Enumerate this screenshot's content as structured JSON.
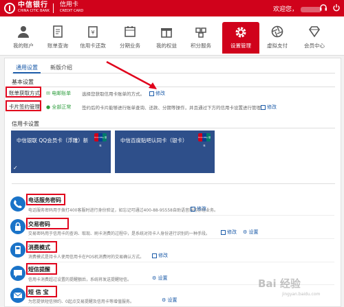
{
  "header": {
    "logo_cn": "中信银行",
    "logo_en": "CHINA CITIC BANK",
    "product": "信用卡",
    "product_en": "CREDIT CARD",
    "welcome": "欢迎您，"
  },
  "nav": {
    "items": [
      {
        "label": "我的账户",
        "icon": "person-icon"
      },
      {
        "label": "账单查询",
        "icon": "bill-icon"
      },
      {
        "label": "信用卡还款",
        "icon": "card-icon"
      },
      {
        "label": "分期业务",
        "icon": "calendar-icon"
      },
      {
        "label": "我的权益",
        "icon": "gift-icon"
      },
      {
        "label": "积分服务",
        "icon": "points-icon"
      },
      {
        "label": "设置管理",
        "icon": "gear-icon"
      },
      {
        "label": "虚拟支付",
        "icon": "aperture-icon"
      },
      {
        "label": "会员中心",
        "icon": "diamond-icon"
      }
    ]
  },
  "tabs": {
    "general": "通用设置",
    "new_version": "新版介绍"
  },
  "basic": {
    "title": "基本设置",
    "rows": [
      {
        "label": "账单获取方式",
        "status": "电邮账单",
        "desc": "选择您获取信用卡账单的方式。",
        "action": "修改"
      },
      {
        "label": "卡片签约管理",
        "status": "全部正常",
        "desc": "签约后的卡片能够进行账单查询、还款、分期等操作，并且通过下方的信用卡设置进行管理",
        "action": "修改"
      }
    ]
  },
  "cards": {
    "title": "信用卡设置",
    "items": [
      {
        "name": "中信银联 QQ会员卡（浮雕）新",
        "brand": "UnionPay 银联"
      },
      {
        "name": "中信百度贴吧认同卡（银卡）",
        "brand": "UnionPay 银联"
      }
    ]
  },
  "services": [
    {
      "title": "电话服务密码",
      "desc": "电话服务密码用于拨打400客服时进行身份验证，如忘记可通过400-88-95558自助语音服务办理业务。",
      "links": [
        "修改"
      ],
      "icon": "phone-icon"
    },
    {
      "title": "交易密码",
      "desc": "交易密码用于信用卡的查询、取现、刷卡消费的过程中，是系统对持卡人身份进行识别的一种手段。",
      "links": [
        "修改",
        "设置"
      ],
      "icon": "lock-icon"
    },
    {
      "title": "消费模式",
      "desc": "消费模式是持卡人使用信用卡在POS机消费时的交易确认方式。",
      "links": [
        "修改"
      ],
      "icon": "pos-icon"
    },
    {
      "title": "短信提醒",
      "desc": "信用卡消费超过设置的提醒额后，系统将发送提醒短信。",
      "links": [
        "设置"
      ],
      "icon": "sms-icon"
    },
    {
      "title": "短 信 宝",
      "desc": "为您提供短信预约、0起点交易提醒及信用卡等增值服务。",
      "links": [
        "设置"
      ],
      "icon": "mail-icon"
    }
  ],
  "watermark": {
    "main": "Bai 经验",
    "sub": "jingyan.baidu.com"
  }
}
